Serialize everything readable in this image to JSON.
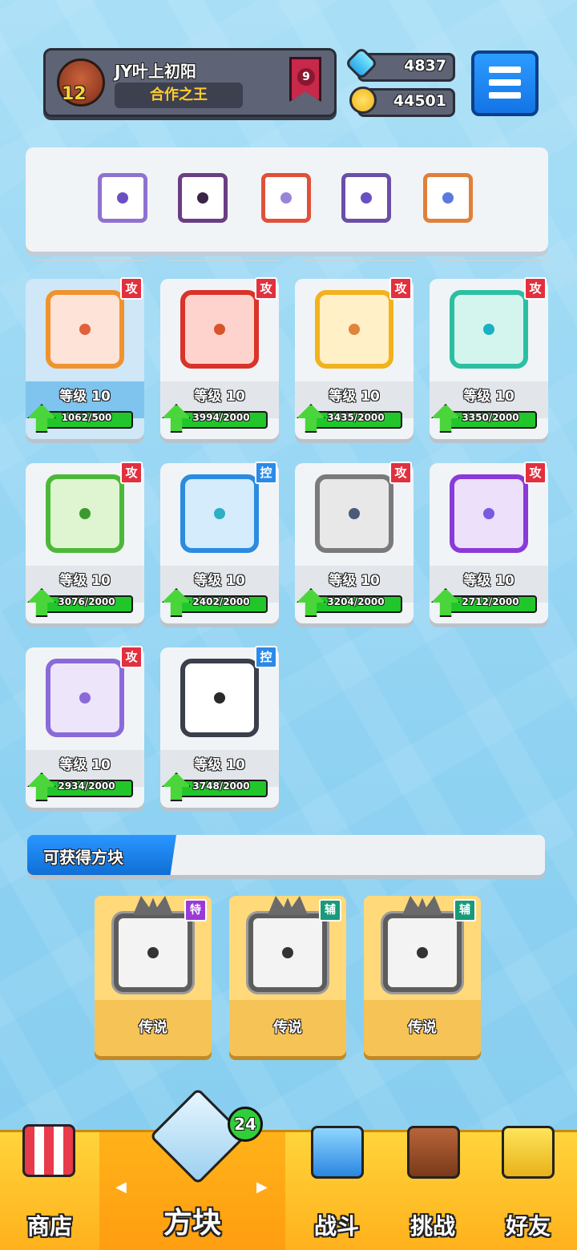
{
  "header": {
    "username": "JY叶上初阳",
    "level": "12",
    "title": "合作之王",
    "rank": "9",
    "gems": "4837",
    "coins": "44501"
  },
  "equipped": [
    {
      "name": "purple-dice",
      "color": "#8e72d1",
      "pip": "#6a4fc4"
    },
    {
      "name": "dark-vortex-dice",
      "color": "#6a3e84",
      "pip": "#3a2448"
    },
    {
      "name": "rainbow-dice",
      "color": "#e0503a",
      "pip": "#9a84d8"
    },
    {
      "name": "purple-dragon-dice",
      "color": "#6a4fa8",
      "pip": "#6a4fc4"
    },
    {
      "name": "infinity-dice",
      "color": "#e0803a",
      "pip": "#5a7ae0"
    }
  ],
  "cards": [
    {
      "tag": "攻",
      "tag_type": "atk",
      "level_label": "等级",
      "level": "10",
      "progress": "1062/500",
      "ratio": 1.0,
      "frame": "#f0922e",
      "bg": "#fde3d8",
      "pip": "#e0623a"
    },
    {
      "tag": "攻",
      "tag_type": "atk",
      "level_label": "等级",
      "level": "10",
      "progress": "3994/2000",
      "ratio": 1.0,
      "frame": "#d9332a",
      "bg": "#ffd3cd",
      "pip": "#d9532a"
    },
    {
      "tag": "攻",
      "tag_type": "atk",
      "level_label": "等级",
      "level": "10",
      "progress": "3435/2000",
      "ratio": 1.0,
      "frame": "#f2b21e",
      "bg": "#fff0c8",
      "pip": "#e0843a"
    },
    {
      "tag": "攻",
      "tag_type": "atk",
      "level_label": "等级",
      "level": "10",
      "progress": "3350/2000",
      "ratio": 1.0,
      "frame": "#2bbfa2",
      "bg": "#d4f5ee",
      "pip": "#1ab0c4"
    },
    {
      "tag": "攻",
      "tag_type": "atk",
      "level_label": "等级",
      "level": "10",
      "progress": "3076/2000",
      "ratio": 1.0,
      "frame": "#4cb83a",
      "bg": "#dff5d2",
      "pip": "#3c9a2c"
    },
    {
      "tag": "控",
      "tag_type": "ctl",
      "level_label": "等级",
      "level": "10",
      "progress": "2402/2000",
      "ratio": 1.0,
      "frame": "#2b8be0",
      "bg": "#d4ecfb",
      "pip": "#2bb0c4"
    },
    {
      "tag": "攻",
      "tag_type": "atk",
      "level_label": "等级",
      "level": "10",
      "progress": "3204/2000",
      "ratio": 1.0,
      "frame": "#7a7a7a",
      "bg": "#e8e8e8",
      "pip": "#4a5a7a"
    },
    {
      "tag": "攻",
      "tag_type": "atk",
      "level_label": "等级",
      "level": "10",
      "progress": "2712/2000",
      "ratio": 1.0,
      "frame": "#8a3ad8",
      "bg": "#ece0fb",
      "pip": "#7a5ae0"
    },
    {
      "tag": "攻",
      "tag_type": "atk",
      "level_label": "等级",
      "level": "10",
      "progress": "2934/2000",
      "ratio": 1.0,
      "frame": "#8a6ad8",
      "bg": "#ede6fb",
      "pip": "#8a6ad8"
    },
    {
      "tag": "控",
      "tag_type": "ctl",
      "level_label": "等级",
      "level": "10",
      "progress": "3748/2000",
      "ratio": 1.0,
      "frame": "#3a3f4a",
      "bg": "#ffffff",
      "pip": "#2a2a2a"
    }
  ],
  "available": {
    "title": "可获得方块",
    "items": [
      {
        "tag": "特",
        "tag_color": "#9a3ad8",
        "label": "传说"
      },
      {
        "tag": "辅",
        "tag_color": "#1a9a7a",
        "label": "传说"
      },
      {
        "tag": "辅",
        "tag_color": "#1a9a7a",
        "label": "传说"
      }
    ]
  },
  "nav": {
    "shop": "商店",
    "dice": "方块",
    "battle": "战斗",
    "challenge": "挑战",
    "friends": "好友",
    "dice_badge": "24"
  }
}
